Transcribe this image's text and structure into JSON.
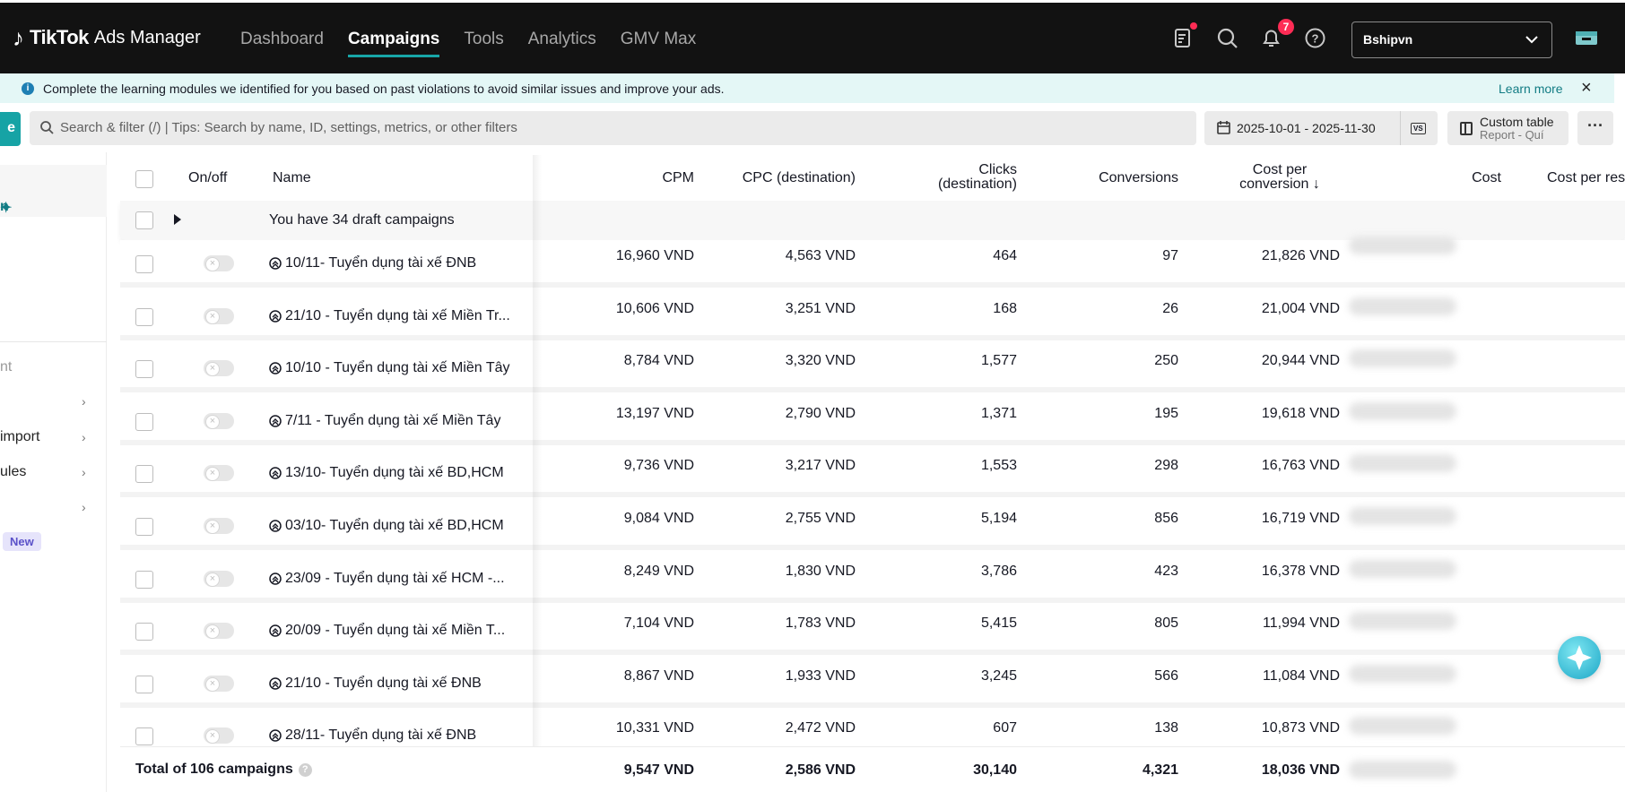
{
  "topbar": {
    "brand": "TikTok",
    "brand_sub": "Ads Manager",
    "nav": [
      {
        "label": "Dashboard",
        "active": false
      },
      {
        "label": "Campaigns",
        "active": true
      },
      {
        "label": "Tools",
        "active": false
      },
      {
        "label": "Analytics",
        "active": false
      },
      {
        "label": "GMV Max",
        "active": false
      }
    ],
    "notification_count": "7",
    "account": "Bshipvn",
    "accent": "#18a6a8"
  },
  "banner": {
    "text": "Complete the learning modules we identified for you based on past violations to avoid similar issues and improve your ads.",
    "learn_more": "Learn more"
  },
  "toolbar": {
    "create_label": "e",
    "search_placeholder": "Search & filter (/) | Tips: Search by name, ID, settings, metrics, or other filters",
    "date_range": "2025-10-01 - 2025-11-30",
    "vs_label": "VS",
    "custom_table": "Custom table",
    "custom_table_sub": "Report - Quí",
    "more": "···"
  },
  "sidebar": {
    "active_label": "n",
    "muted_label": "nt",
    "items": [
      {
        "label": "",
        "chevron": "›"
      },
      {
        "label": "import",
        "chevron": "›"
      },
      {
        "label": "ules",
        "chevron": "›"
      },
      {
        "label": "",
        "chevron": "›"
      }
    ],
    "new_badge": "New"
  },
  "table": {
    "headers": {
      "onoff": "On/off",
      "name": "Name",
      "cpm": "CPM",
      "cpc": "CPC (destination)",
      "clicks_1": "Clicks",
      "clicks_2": "(destination)",
      "conversions": "Conversions",
      "cpconv_1": "Cost per",
      "cpconv_2": "conversion ↓",
      "cost": "Cost",
      "cost_per_res": "Cost per res"
    },
    "draft_text": "You have 34 draft campaigns",
    "rows": [
      {
        "name": "10/11- Tuyển dụng tài xế ĐNB",
        "cpm": "16,960 VND",
        "cpc": "4,563 VND",
        "clicks": "464",
        "conversions": "97",
        "cpconv": "21,826 VND"
      },
      {
        "name": "21/10 - Tuyển dụng tài xế Miền Tr...",
        "cpm": "10,606 VND",
        "cpc": "3,251 VND",
        "clicks": "168",
        "conversions": "26",
        "cpconv": "21,004 VND"
      },
      {
        "name": "10/10 - Tuyển dụng tài xế Miền Tây",
        "cpm": "8,784 VND",
        "cpc": "3,320 VND",
        "clicks": "1,577",
        "conversions": "250",
        "cpconv": "20,944 VND"
      },
      {
        "name": "7/11 - Tuyển dụng tài xế Miền Tây",
        "cpm": "13,197 VND",
        "cpc": "2,790 VND",
        "clicks": "1,371",
        "conversions": "195",
        "cpconv": "19,618 VND"
      },
      {
        "name": "13/10- Tuyển dụng tài xế BD,HCM",
        "cpm": "9,736 VND",
        "cpc": "3,217 VND",
        "clicks": "1,553",
        "conversions": "298",
        "cpconv": "16,763 VND"
      },
      {
        "name": "03/10- Tuyển dụng tài xế BD,HCM",
        "cpm": "9,084 VND",
        "cpc": "2,755 VND",
        "clicks": "5,194",
        "conversions": "856",
        "cpconv": "16,719 VND"
      },
      {
        "name": "23/09 - Tuyển dụng tài xế HCM -...",
        "cpm": "8,249 VND",
        "cpc": "1,830 VND",
        "clicks": "3,786",
        "conversions": "423",
        "cpconv": "16,378 VND"
      },
      {
        "name": "20/09 - Tuyển dụng tài xế Miền T...",
        "cpm": "7,104 VND",
        "cpc": "1,783 VND",
        "clicks": "5,415",
        "conversions": "805",
        "cpconv": "11,994 VND"
      },
      {
        "name": "21/10 - Tuyển dụng tài xế ĐNB",
        "cpm": "8,867 VND",
        "cpc": "1,933 VND",
        "clicks": "3,245",
        "conversions": "566",
        "cpconv": "11,084 VND"
      },
      {
        "name": "28/11- Tuyển dụng tài xế ĐNB",
        "cpm": "10,331 VND",
        "cpc": "2,472 VND",
        "clicks": "607",
        "conversions": "138",
        "cpconv": "10,873 VND"
      }
    ],
    "total": {
      "label": "Total of 106 campaigns",
      "cpm": "9,547 VND",
      "cpc": "2,586 VND",
      "clicks": "30,140",
      "conversions": "4,321",
      "cpconv": "18,036 VND"
    }
  }
}
